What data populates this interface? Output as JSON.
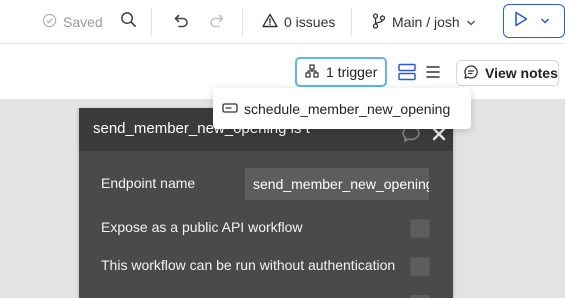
{
  "toolbar": {
    "saved_label": "Saved",
    "issues_label": "0 issues",
    "branch_label": "Main / josh"
  },
  "subbar": {
    "trigger_label": "1 trigger",
    "view_notes_label": "View notes"
  },
  "dropdown": {
    "items": [
      {
        "label": "schedule_member_new_opening",
        "icon": "api-icon"
      }
    ]
  },
  "panel": {
    "title": "send_member_new_opening is t",
    "endpoint_label": "Endpoint name",
    "endpoint_value": "send_member_new_opening",
    "expose_label": "Expose as a public API workflow",
    "no_auth_label": "This workflow can be run without authentication"
  },
  "colors": {
    "accent": "#2a5bd7",
    "trigger_border": "#62b6e8",
    "panel_bg": "#4a4a4a",
    "panel_header": "#3b3b3b",
    "canvas_bg": "#e3e3e3"
  }
}
